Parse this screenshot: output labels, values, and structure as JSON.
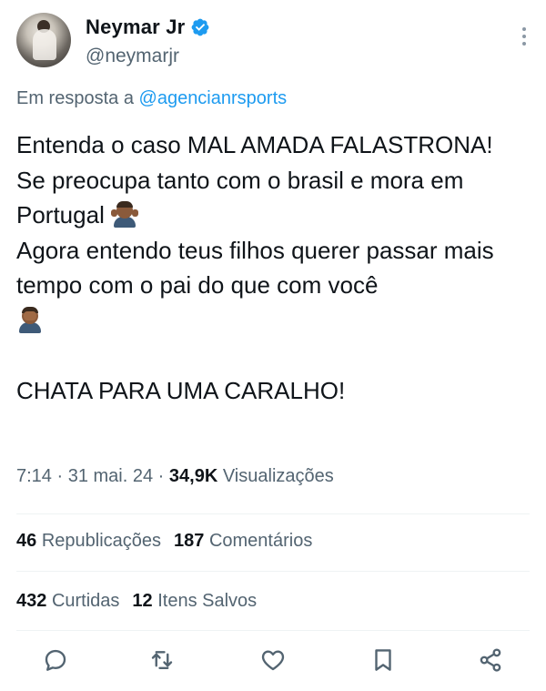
{
  "author": {
    "name": "Neymar Jr",
    "handle": "@neymarjr"
  },
  "reply": {
    "prefix": "Em resposta a",
    "mention": "@agencianrsports"
  },
  "tweet": {
    "line1": "Entenda o caso MAL AMADA FALASTRONA!",
    "line2": "Se preocupa tanto com o brasil e mora em Portugal",
    "line3": "Agora entendo teus filhos querer passar mais tempo com o pai do que com você",
    "line4": "CHATA PARA UMA CARALHO!",
    "emoji1": "person-shrugging",
    "emoji2": "person-facepalming"
  },
  "meta": {
    "time": "7:14",
    "date": "31 mai. 24",
    "views_count": "34,9K",
    "views_label": "Visualizações"
  },
  "stats": {
    "reposts_count": "46",
    "reposts_label": "Republicações",
    "comments_count": "187",
    "comments_label": "Comentários",
    "likes_count": "432",
    "likes_label": "Curtidas",
    "saves_count": "12",
    "saves_label": "Itens Salvos"
  },
  "actions": [
    "reply-icon",
    "repost-icon",
    "like-icon",
    "bookmark-icon",
    "share-icon"
  ],
  "colors": {
    "accent": "#1d9bf0",
    "text": "#0f1419",
    "secondary": "#536471",
    "divider": "#eff3f4"
  }
}
